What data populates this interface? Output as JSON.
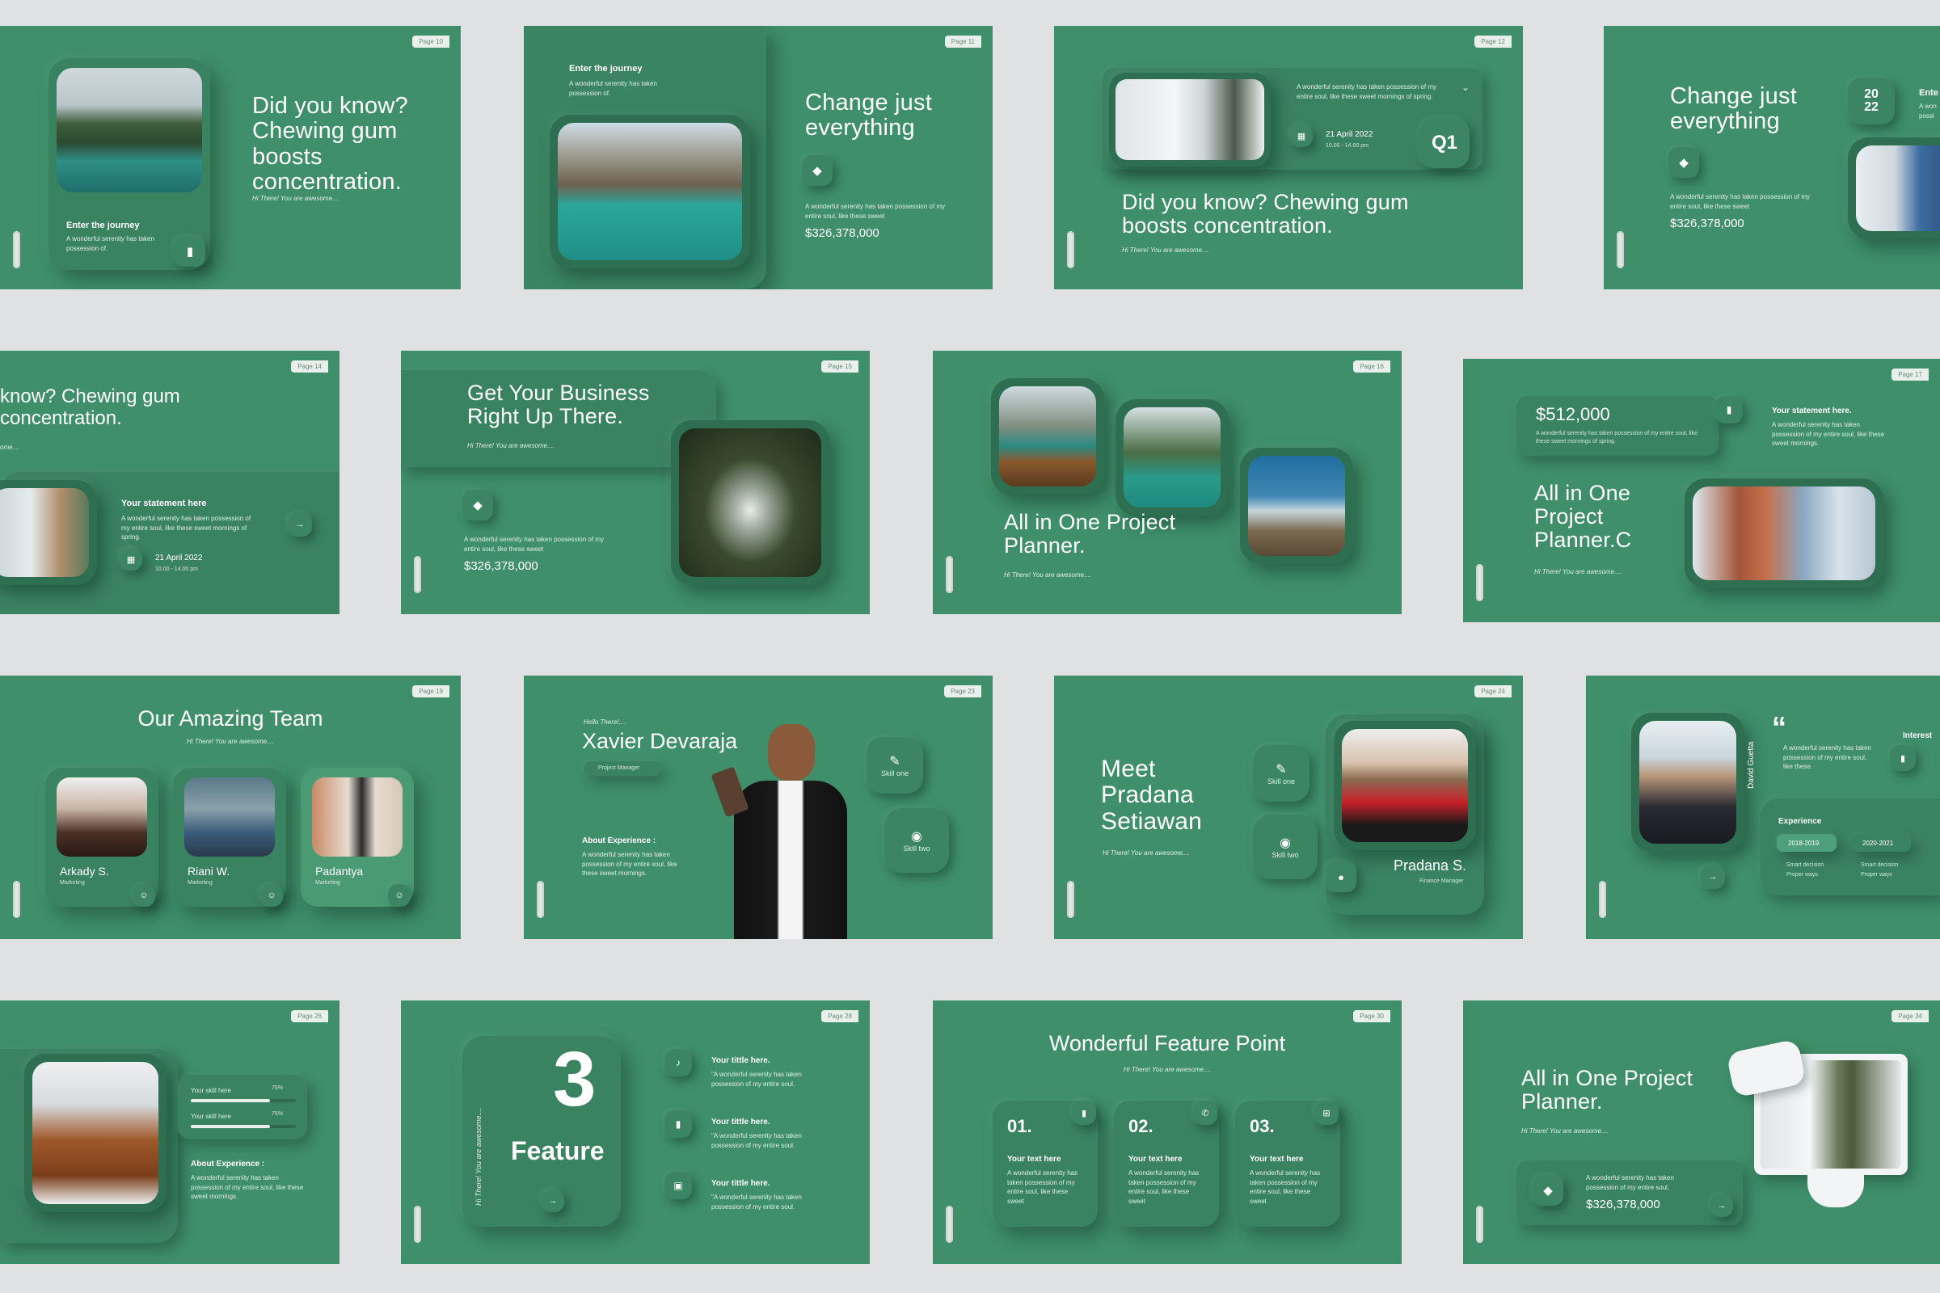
{
  "common": {
    "enter_journey": "Enter the journey",
    "serenity_short": "A wonderful serenity has taken possession of.",
    "serenity_sweet": "A wonderful serenity has taken possession of my entire soul, like these sweet",
    "hi_there": "Hi There! You are awesome....",
    "amount": "$326,378,000",
    "did_you_know": "Did you know? Chewing gum boosts concentration.",
    "change_just": "Change just everything",
    "all_in_one": "All in One Project Planner.",
    "spring_text": "A wonderful serenity has taken possession of my entire soul, like these sweet mornings of spring.",
    "date": "21 April 2022",
    "time": "10.00 - 14.00 pm",
    "your_statement": "Your statement here",
    "your_statement_dot": "Your statement here.",
    "statement_text": "A wonderful serenity has taken possession of my entire soul, like these sweet mornings of spring.",
    "text_here": "Your text here",
    "text_here_body": "A wonderful serenity has taken possession of my entire soul, like these sweet",
    "your_title": "Your tittle here.",
    "title_body": "\"A wonderful serenity has taken possession of my entire soul.",
    "skill_one": "Skill one",
    "skill_two": "Skill two"
  },
  "slides": {
    "s1": {
      "page": "Page 10",
      "title": "Did you know? Chewing gum boosts concentration."
    },
    "s2": {
      "page": "Page 11"
    },
    "s3": {
      "page": "Page 12",
      "q": "Q1"
    },
    "s4": {
      "page": "Page 13",
      "year": "20 22",
      "ente": "Ente",
      "awe": "A won possi"
    },
    "s5": {
      "page": "Page 14",
      "title": "know? Chewing gum concentration.",
      "sub": "ome...."
    },
    "s6": {
      "page": "Page 15",
      "title": "Get Your Business Right Up There."
    },
    "s7": {
      "page": "Page 16"
    },
    "s8": {
      "page": "Page 17",
      "amount": "$512,000",
      "title": "All in One Project Planner.C",
      "body": "A wonderful serenity has taken possession of my entire soul, like these sweet mornings of spring.",
      "stmt_body": "A wonderful serenity has taken possession of my entire soul, like these sweet mornings."
    },
    "s9": {
      "page": "Page 19",
      "title": "Our Amazing Team",
      "members": [
        {
          "name": "Arkady S.",
          "role": "Marketing"
        },
        {
          "name": "Riani W.",
          "role": "Marketing"
        },
        {
          "name": "Padantya",
          "role": "Marketing"
        }
      ]
    },
    "s10": {
      "page": "Page 23",
      "hello": "Hello There!....",
      "name": "Xavier Devaraja",
      "role": "Project Manager",
      "about": "About Experience :",
      "about_body": "A wonderful serenity has taken possession of my entire soul, like these sweet mornings."
    },
    "s11": {
      "page": "Page 24",
      "title": "Meet Pradana Setiawan",
      "name": "Pradana S.",
      "role": "Finance Manager"
    },
    "s12": {
      "page": "Page 25",
      "quote_mark": "“",
      "quote": "A wonderful serenity has taken possession of my entire soul, like these.",
      "interest": "Interest",
      "vertical": "David Guetta",
      "experience": "Experience",
      "years": [
        "2018-2019",
        "2020-2021"
      ],
      "bullets": [
        "Smart decision",
        "Proper ways"
      ]
    },
    "s13": {
      "page": "Page 26",
      "skill1": "Your skill here",
      "skill2": "Your skill here",
      "pct1": "75%",
      "pct2": "75%",
      "skill1_value": 0.75,
      "skill2_value": 0.75,
      "about": "About Experience :",
      "about_body": "A wonderful serenity has taken possession of my entire soul, like these sweet mornings."
    },
    "s14": {
      "page": "Page 28",
      "number": "3",
      "label": "Feature",
      "vertical": "Hi There! You are awesome...."
    },
    "s15": {
      "page": "Page 30",
      "title": "Wonderful Feature Point",
      "nums": [
        "01.",
        "02.",
        "03."
      ]
    },
    "s16": {
      "page": "Page 34",
      "body": "A wonderful serenity has taken possession of my entire soul."
    }
  },
  "colors": {
    "slide_bg": "#3f8f6a",
    "page_bg": "#dfe1e2"
  }
}
